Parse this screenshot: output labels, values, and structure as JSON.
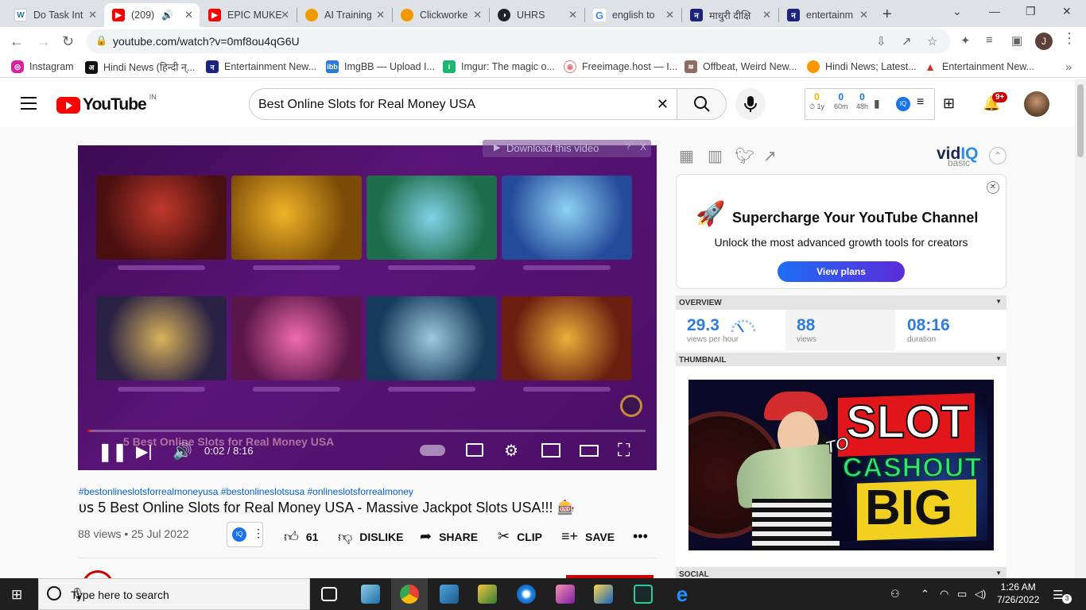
{
  "browser": {
    "tabs": [
      {
        "label": "Do Task Int",
        "icon": "wordpress-icon",
        "color": "#21759b"
      },
      {
        "label": "(209)",
        "icon": "youtube-icon",
        "color": "#ff0000"
      },
      {
        "label": "EPIC MUKE",
        "icon": "youtube-icon",
        "color": "#ff0000"
      },
      {
        "label": "AI Training",
        "icon": "clickworker-icon",
        "color": "#f29900"
      },
      {
        "label": "Clickworke",
        "icon": "clickworker-icon",
        "color": "#f29900"
      },
      {
        "label": "UHRS",
        "icon": "uhrs-icon",
        "color": "#202124"
      },
      {
        "label": "english to",
        "icon": "google-icon",
        "color": "#4285f4"
      },
      {
        "label": "माधुरी दीक्षि",
        "icon": "news-icon",
        "color": "#1a237e"
      },
      {
        "label": "entertainm",
        "icon": "news-icon",
        "color": "#1a237e"
      }
    ],
    "url": "youtube.com/watch?v=0mf8ou4qG6U",
    "profile_initial": "J",
    "bookmarks": [
      {
        "label": "Instagram",
        "color": "#d6249f"
      },
      {
        "label": "Hindi News (हिन्दी न्...",
        "color": "#111111"
      },
      {
        "label": "Entertainment New...",
        "color": "#1a237e"
      },
      {
        "label": "ImgBB — Upload I...",
        "color": "#2a7ae2"
      },
      {
        "label": "Imgur: The magic o...",
        "color": "#1bb76e"
      },
      {
        "label": "Freeimage.host — I...",
        "color": "#e57373"
      },
      {
        "label": "Offbeat, Weird New...",
        "color": "#8d6e63"
      },
      {
        "label": "Hindi News; Latest...",
        "color": "#ff9800"
      },
      {
        "label": "Entertainment New...",
        "color": "#d32f2f"
      }
    ]
  },
  "youtube": {
    "logo": "YouTube",
    "country": "IN",
    "search_query": "Best Online Slots for Real Money USA",
    "vidiq_stats": [
      {
        "value": "0",
        "label": "1y",
        "color": "#f5b400"
      },
      {
        "value": "0",
        "label": "60m",
        "color": "#1a73e8"
      },
      {
        "value": "0",
        "label": "48h",
        "color": "#1a73e8"
      }
    ],
    "notifications": "9+",
    "player": {
      "download_label": "Download this video",
      "download_help": "?",
      "download_close": "X",
      "overlay_title": "5 Best Online Slots for Real Money USA",
      "time": "0:02 / 8:16",
      "progress": 0.004
    },
    "hashtags": "#bestonlineslotsforrealmoneyusa #bestonlineslotsusa #onlineslotsforrealmoney",
    "title": "ᴜꜱ 5 Best Online Slots for Real Money USA - Massive Jackpot Slots USA!!! 🎰",
    "views_date": "88 views • 25 Jul 2022",
    "actions": {
      "likes": "61",
      "dislike": "DISLIKE",
      "share": "SHARE",
      "clip": "CLIP",
      "save": "SAVE"
    }
  },
  "vidiq": {
    "logo_a": "vid",
    "logo_b": "IQ",
    "plan": "basic",
    "promo_title": "Supercharge Your YouTube Channel",
    "promo_sub": "Unlock the most advanced growth tools for creators",
    "promo_button": "View plans",
    "sections": {
      "overview": "OVERVIEW",
      "thumbnail": "THUMBNAIL",
      "social": "SOCIAL"
    },
    "overview": [
      {
        "value": "29.3",
        "label": "views per hour"
      },
      {
        "value": "88",
        "label": "views"
      },
      {
        "value": "08:16",
        "label": "duration"
      }
    ],
    "thumbnail_text": {
      "word1": "SLOT",
      "word2": "TO",
      "word3": "CASHOUT",
      "word4": "BIG"
    }
  },
  "taskbar": {
    "search_placeholder": "Type here to search",
    "time": "1:26 AM",
    "date": "7/26/2022",
    "notif_count": "3"
  }
}
